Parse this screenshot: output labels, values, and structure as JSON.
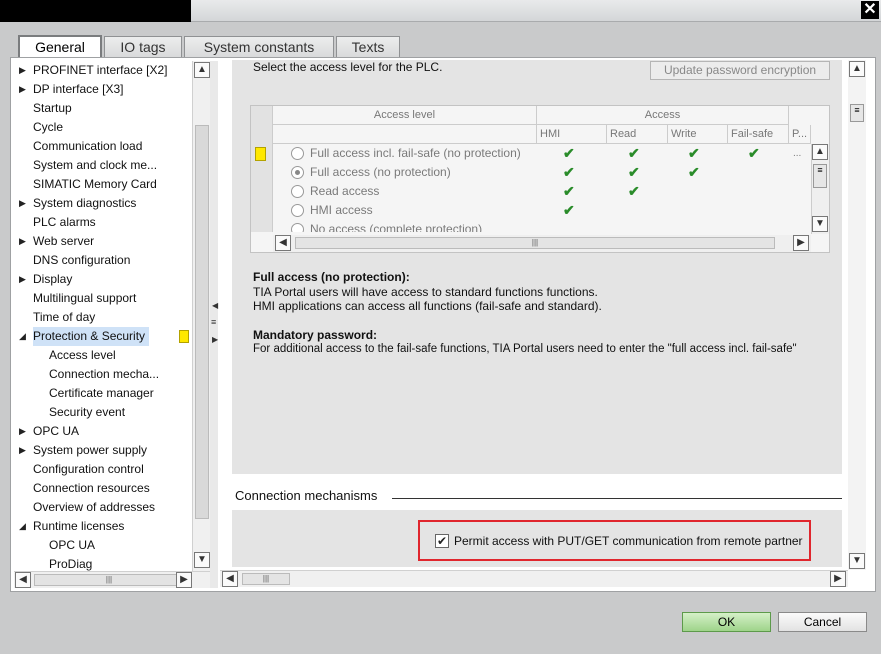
{
  "window": {
    "close_glyph": "✕"
  },
  "tabs": [
    "General",
    "IO tags",
    "System constants",
    "Texts"
  ],
  "tree": [
    {
      "label": "PROFINET interface [X2]",
      "arrow": "▶",
      "indent": 0
    },
    {
      "label": "DP interface [X3]",
      "arrow": "▶",
      "indent": 0
    },
    {
      "label": "Startup",
      "arrow": "",
      "indent": 0
    },
    {
      "label": "Cycle",
      "arrow": "",
      "indent": 0
    },
    {
      "label": "Communication load",
      "arrow": "",
      "indent": 0
    },
    {
      "label": "System and clock me...",
      "arrow": "",
      "indent": 0
    },
    {
      "label": "SIMATIC Memory Card",
      "arrow": "",
      "indent": 0
    },
    {
      "label": "System diagnostics",
      "arrow": "▶",
      "indent": 0
    },
    {
      "label": "PLC alarms",
      "arrow": "",
      "indent": 0
    },
    {
      "label": "Web server",
      "arrow": "▶",
      "indent": 0
    },
    {
      "label": "DNS configuration",
      "arrow": "",
      "indent": 0
    },
    {
      "label": "Display",
      "arrow": "▶",
      "indent": 0
    },
    {
      "label": "Multilingual support",
      "arrow": "",
      "indent": 0
    },
    {
      "label": "Time of day",
      "arrow": "",
      "indent": 0
    },
    {
      "label": "Protection & Security",
      "arrow": "◢",
      "indent": 0,
      "selected": true
    },
    {
      "label": "Access level",
      "arrow": "",
      "indent": 1
    },
    {
      "label": "Connection mecha...",
      "arrow": "",
      "indent": 1
    },
    {
      "label": "Certificate manager",
      "arrow": "",
      "indent": 1
    },
    {
      "label": "Security event",
      "arrow": "",
      "indent": 1
    },
    {
      "label": "OPC UA",
      "arrow": "▶",
      "indent": 0
    },
    {
      "label": "System power supply",
      "arrow": "▶",
      "indent": 0
    },
    {
      "label": "Configuration control",
      "arrow": "",
      "indent": 0
    },
    {
      "label": "Connection resources",
      "arrow": "",
      "indent": 0
    },
    {
      "label": "Overview of addresses",
      "arrow": "",
      "indent": 0
    },
    {
      "label": "Runtime licenses",
      "arrow": "◢",
      "indent": 0
    },
    {
      "label": "OPC UA",
      "arrow": "",
      "indent": 1
    },
    {
      "label": "ProDiag",
      "arrow": "",
      "indent": 1
    }
  ],
  "access": {
    "intro": "Select the access level for the PLC.",
    "update_button": "Update password encryption",
    "col_access_level": "Access level",
    "col_access": "Access",
    "sub_cols": [
      "HMI",
      "Read",
      "Write",
      "Fail-safe",
      "P..."
    ],
    "rows": [
      {
        "label": "Full access incl. fail-safe (no protection)",
        "checks": [
          true,
          true,
          true,
          true
        ],
        "more": "..."
      },
      {
        "label": "Full access (no protection)",
        "checks": [
          true,
          true,
          true,
          false
        ],
        "selected": true
      },
      {
        "label": "Read access",
        "checks": [
          true,
          true,
          false,
          false
        ]
      },
      {
        "label": "HMI access",
        "checks": [
          true,
          false,
          false,
          false
        ]
      },
      {
        "label": "No access (complete protection)",
        "checks": [
          false,
          false,
          false,
          false
        ]
      }
    ],
    "check_glyph": "✔",
    "scroll_glyph": "|||",
    "desc_title": "Full access (no protection):",
    "desc_line1": "TIA Portal users will have access to standard functions functions.",
    "desc_line2": "HMI applications can access all functions (fail-safe and standard).",
    "mand_title": "Mandatory password:",
    "mand_line": "For additional access to the fail-safe functions, TIA Portal users need to enter the \"full access incl. fail-safe\""
  },
  "connection": {
    "heading": "Connection mechanisms",
    "permit_label": "Permit access with PUT/GET communication from remote partner",
    "checked": "✔"
  },
  "buttons": {
    "ok": "OK",
    "cancel": "Cancel"
  },
  "colors": {
    "highlight": "#e0262d",
    "marker": "#ffe800",
    "check": "#2a8c2a"
  }
}
